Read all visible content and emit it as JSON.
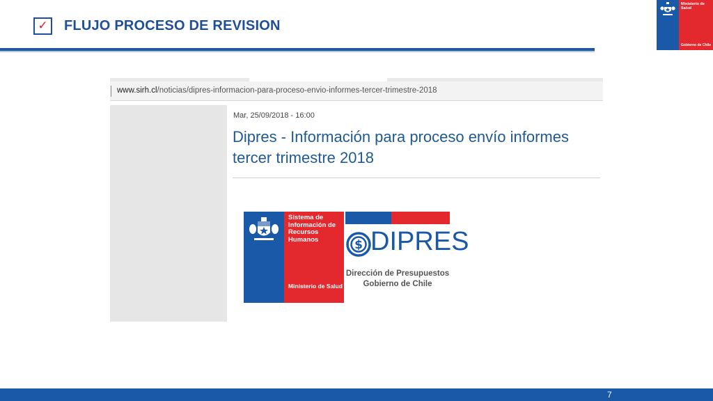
{
  "slide": {
    "title": "FLUJO PROCESO DE REVISION",
    "page_number": "7",
    "colors": {
      "accent": "#1f4e9a",
      "red": "#e3282e",
      "blue": "#1a59a8"
    }
  },
  "ministry_logo": {
    "name": "Ministerio de Salud",
    "government": "Gobierno de Chile"
  },
  "screenshot": {
    "url_domain": "www.sirh.cl",
    "url_path": "/noticias/dipres-informacion-para-proceso-envio-informes-tercer-trimestre-2018",
    "post_date": "Mar, 25/09/2018 - 16:00",
    "post_title": "Dipres - Información para proceso envío informes tercer trimestre 2018"
  },
  "sirh_logo": {
    "name": "Sistema de Información de Recursos Humanos",
    "ministry": "Ministerio de Salud"
  },
  "dipres_logo": {
    "wordmark": "DIPRES",
    "subtitle_line1": "Dirección de Presupuestos",
    "subtitle_line2": "Gobierno de Chile"
  }
}
